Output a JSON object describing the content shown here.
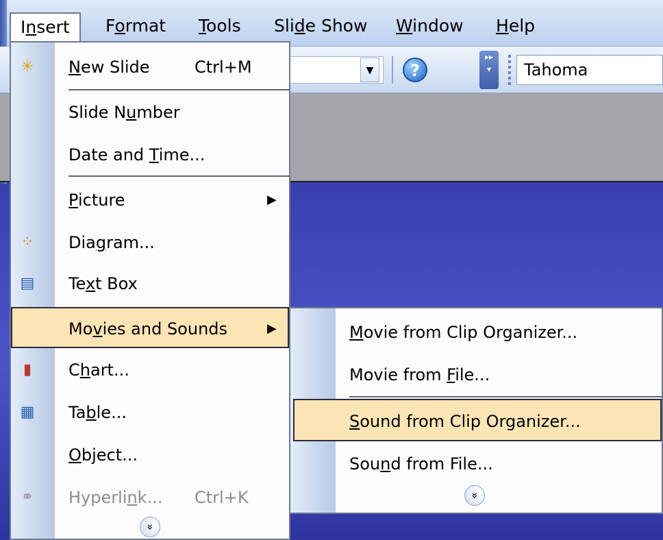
{
  "menubar": {
    "items": [
      {
        "label": "Insert",
        "mnemonic_index": 1,
        "active": true
      },
      {
        "label": "Format",
        "mnemonic_index": 1,
        "active": false
      },
      {
        "label": "Tools",
        "mnemonic_index": 0,
        "active": false
      },
      {
        "label": "Slide Show",
        "mnemonic_index": 3,
        "active": false
      },
      {
        "label": "Window",
        "mnemonic_index": 0,
        "active": false
      },
      {
        "label": "Help",
        "mnemonic_index": 0,
        "active": false
      }
    ]
  },
  "toolbar": {
    "help_icon": "?",
    "font_name": "Tahoma"
  },
  "insert_menu": {
    "items": [
      {
        "label": "New Slide",
        "shortcut": "Ctrl+M",
        "icon": "new-slide-icon",
        "glyph": "✳",
        "underline": 0
      },
      {
        "label": "Slide Number",
        "shortcut": "",
        "icon": "",
        "glyph": "",
        "underline": 7
      },
      {
        "label": "Date and Time...",
        "shortcut": "",
        "icon": "",
        "glyph": "",
        "underline": 9
      },
      {
        "label": "Picture",
        "shortcut": "",
        "icon": "",
        "glyph": "",
        "underline": 0,
        "submenu": true
      },
      {
        "label": "Diagram...",
        "shortcut": "",
        "icon": "diagram-icon",
        "glyph": "⁘",
        "underline": 3
      },
      {
        "label": "Text Box",
        "shortcut": "",
        "icon": "text-box-icon",
        "glyph": "▤",
        "underline": 2
      },
      {
        "label": "Movies and Sounds",
        "shortcut": "",
        "icon": "",
        "glyph": "",
        "underline": 2,
        "submenu": true,
        "selected": true
      },
      {
        "label": "Chart...",
        "shortcut": "",
        "icon": "chart-icon",
        "glyph": "▮",
        "underline": 1
      },
      {
        "label": "Table...",
        "shortcut": "",
        "icon": "table-icon",
        "glyph": "▦",
        "underline": 2
      },
      {
        "label": "Object...",
        "shortcut": "",
        "icon": "",
        "glyph": "",
        "underline": 0
      },
      {
        "label": "Hyperlink...",
        "shortcut": "Ctrl+K",
        "icon": "hyperlink-icon",
        "glyph": "⚭",
        "underline": 7,
        "disabled": true
      }
    ],
    "expand_glyph": "»"
  },
  "submenu": {
    "items": [
      {
        "label": "Movie from Clip Organizer...",
        "underline": 0
      },
      {
        "label": "Movie from File...",
        "underline": 11
      },
      {
        "label": "Sound from Clip Organizer...",
        "underline": 0,
        "selected": true
      },
      {
        "label": "Sound from File...",
        "underline": 3
      }
    ],
    "expand_glyph": "»"
  },
  "colors": {
    "highlight": "#fbe5b4",
    "highlight_border": "#2b2b3f",
    "menu_bg": "#fcfcfc",
    "slide_bg": "#3a3fb0"
  }
}
